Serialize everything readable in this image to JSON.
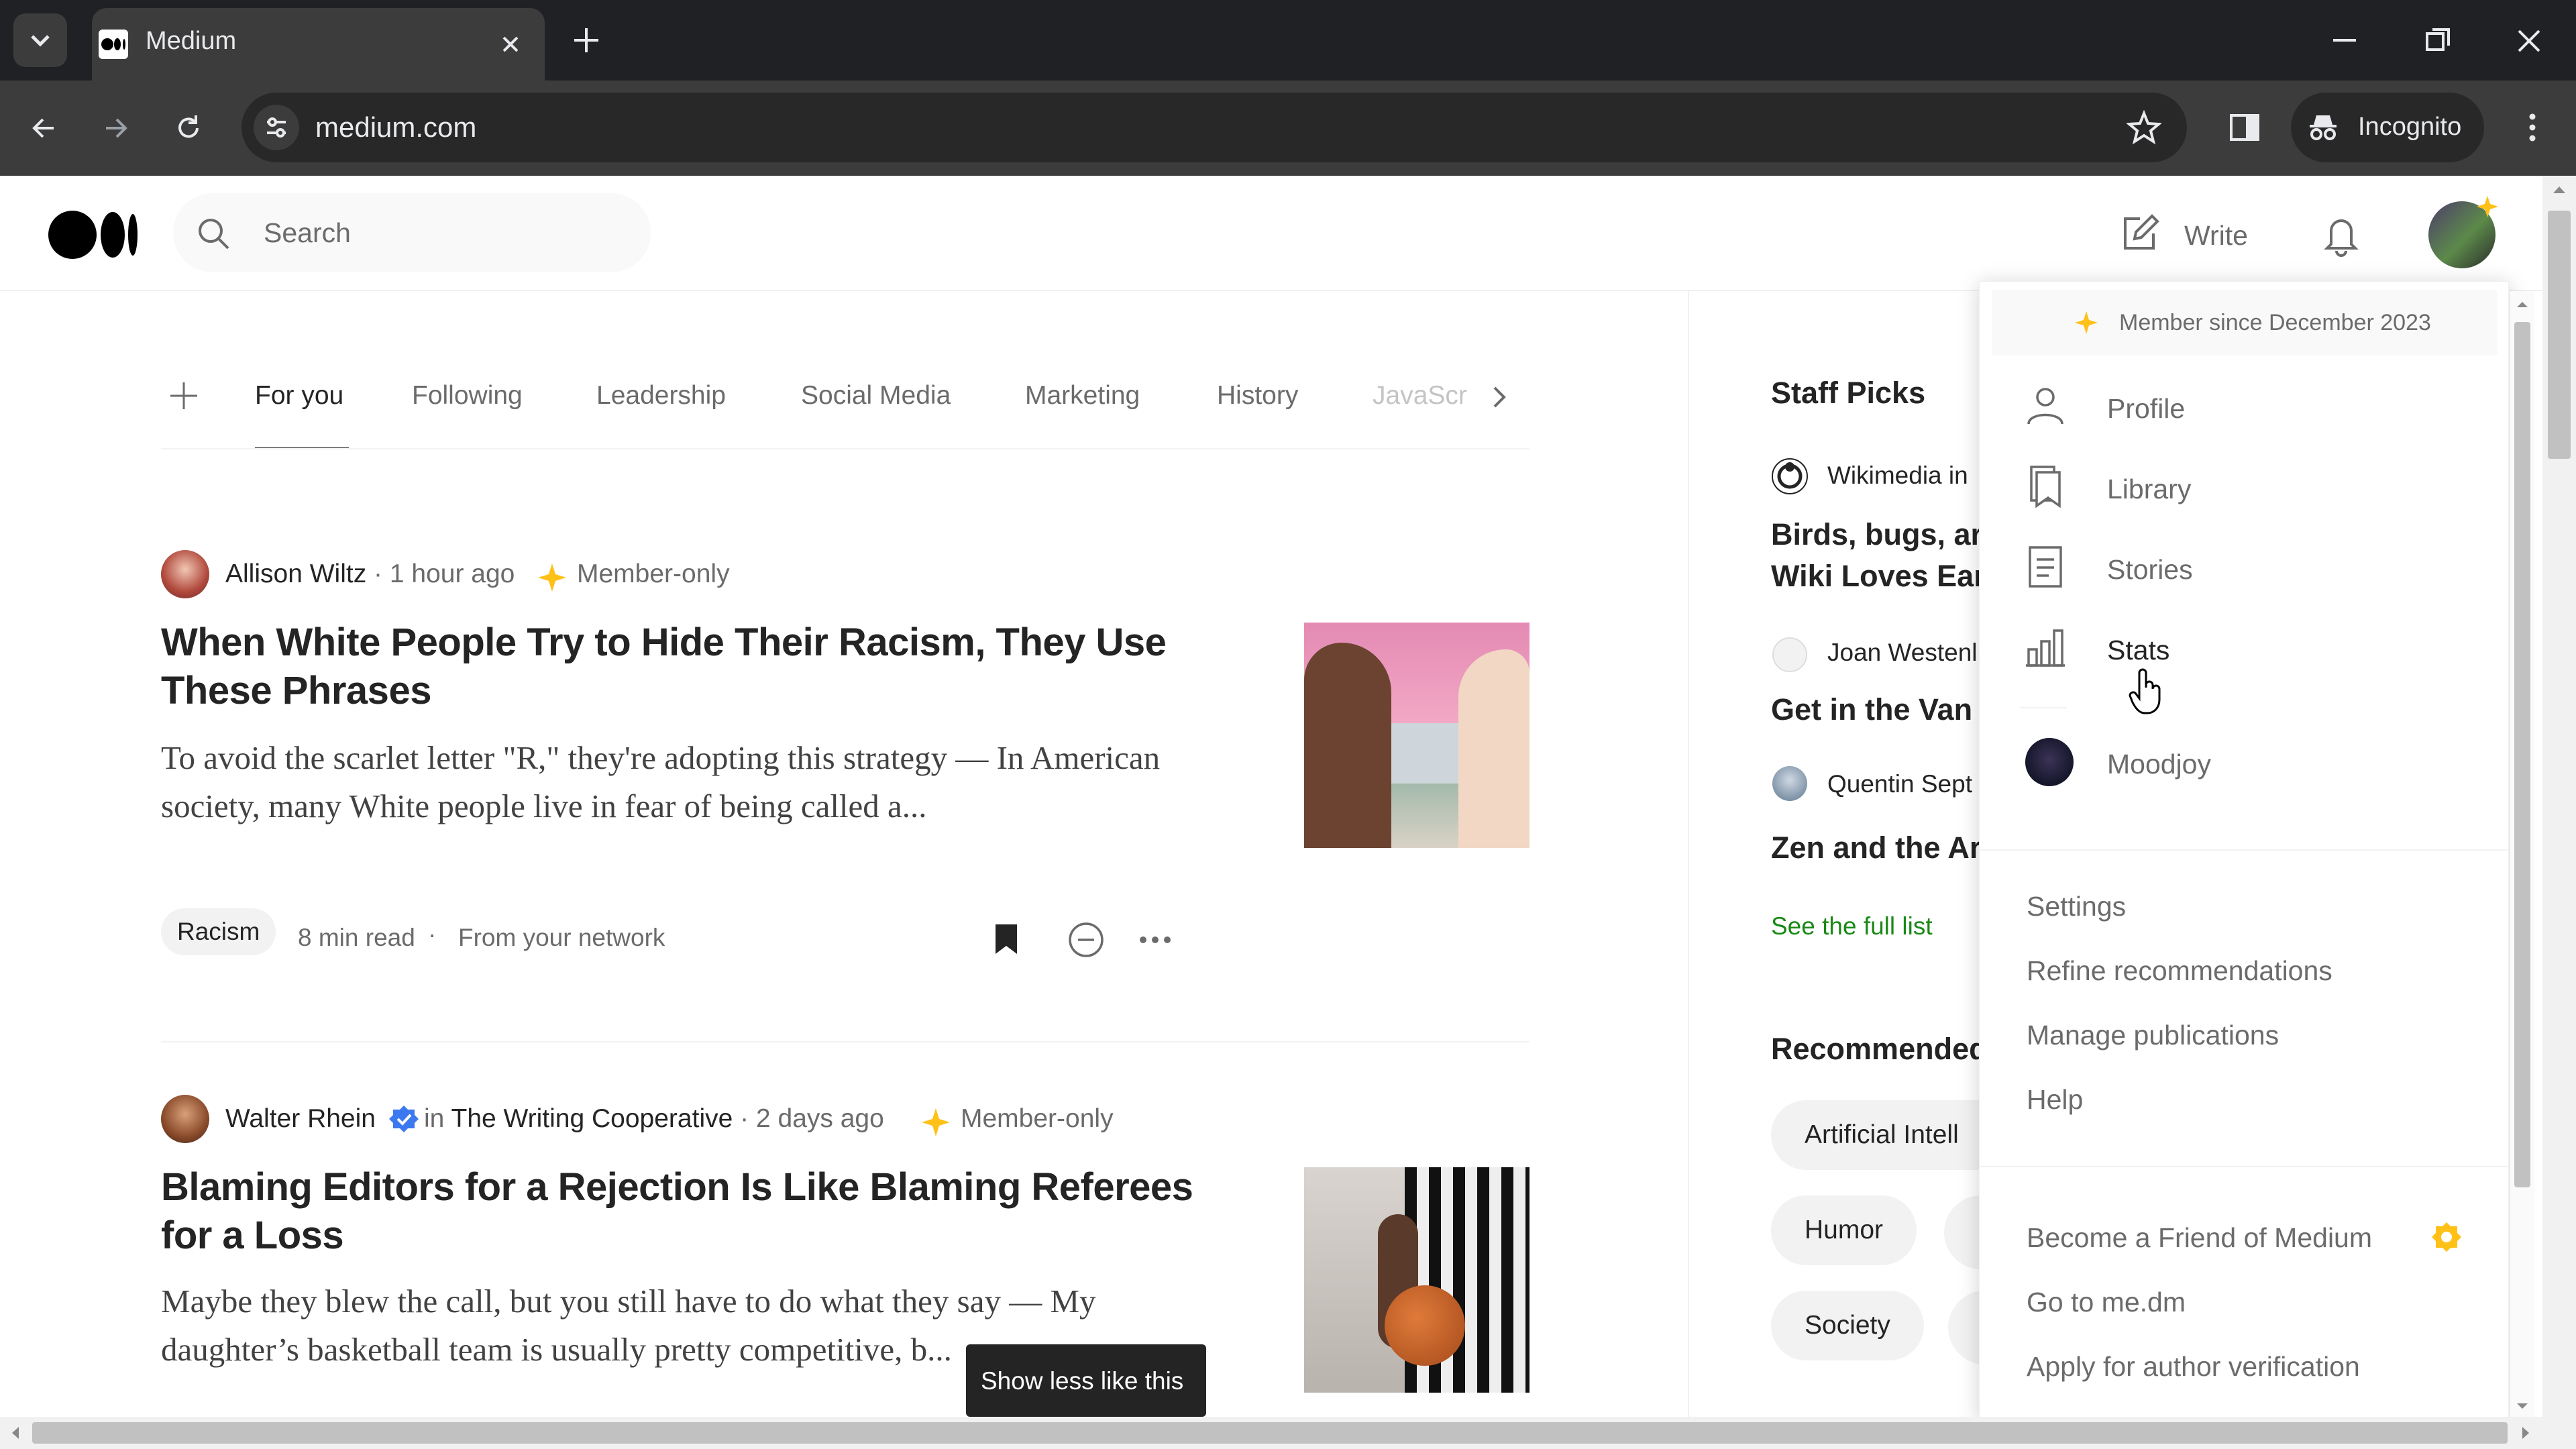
{
  "browser": {
    "tab_title": "Medium",
    "url": "medium.com",
    "incognito_label": "Incognito"
  },
  "header": {
    "search_placeholder": "Search",
    "write_label": "Write"
  },
  "topics": [
    "For you",
    "Following",
    "Leadership",
    "Social Media",
    "Marketing",
    "History",
    "JavaScr"
  ],
  "articles": [
    {
      "author": "Allison Wiltz",
      "time": "1 hour ago",
      "member": "Member-only",
      "title": "When White People Try to Hide Their Racism, They Use These Phrases",
      "excerpt": "To avoid the scarlet letter \"R,\" they're adopting this strategy — In American society, many White people live in fear of being called a...",
      "tag": "Racism",
      "read_time": "8 min read",
      "source": "From your network"
    },
    {
      "author": "Walter Rhein",
      "in_label": "in",
      "publication": "The Writing Cooperative",
      "time": "2 days ago",
      "member": "Member-only",
      "title": "Blaming Editors for a Rejection Is Like Blaming Referees for a Loss",
      "excerpt": "Maybe they blew the call, but you still have to do what they say — My daughter’s basketball team is usually pretty competitive, b..."
    }
  ],
  "tooltip": "Show less like this",
  "sidebar": {
    "staff_picks_title": "Staff Picks",
    "picks": [
      {
        "author": "Wikimedia in",
        "title_l1": "Birds, bugs, ar",
        "title_l2": "Wiki Loves Ear"
      },
      {
        "author": "Joan Westenl",
        "title_l1": "Get in the Van"
      },
      {
        "author": "Quentin Sept",
        "title_l1": "Zen and the Ar"
      }
    ],
    "see_full_list": "See the full list",
    "recommended_title": "Recommended",
    "rec_topics": [
      "Artificial Intell",
      "Humor",
      "Society"
    ]
  },
  "menu": {
    "member_since": "Member since December 2023",
    "items": [
      "Profile",
      "Library",
      "Stories",
      "Stats"
    ],
    "account": "Moodjoy",
    "links": [
      "Settings",
      "Refine recommendations",
      "Manage publications",
      "Help"
    ],
    "footer": [
      "Become a Friend of Medium",
      "Go to me.dm",
      "Apply for author verification"
    ]
  },
  "colors": {
    "accent_green": "#1a8917",
    "member_star": "#ffc017",
    "chrome_dark": "#202124"
  }
}
